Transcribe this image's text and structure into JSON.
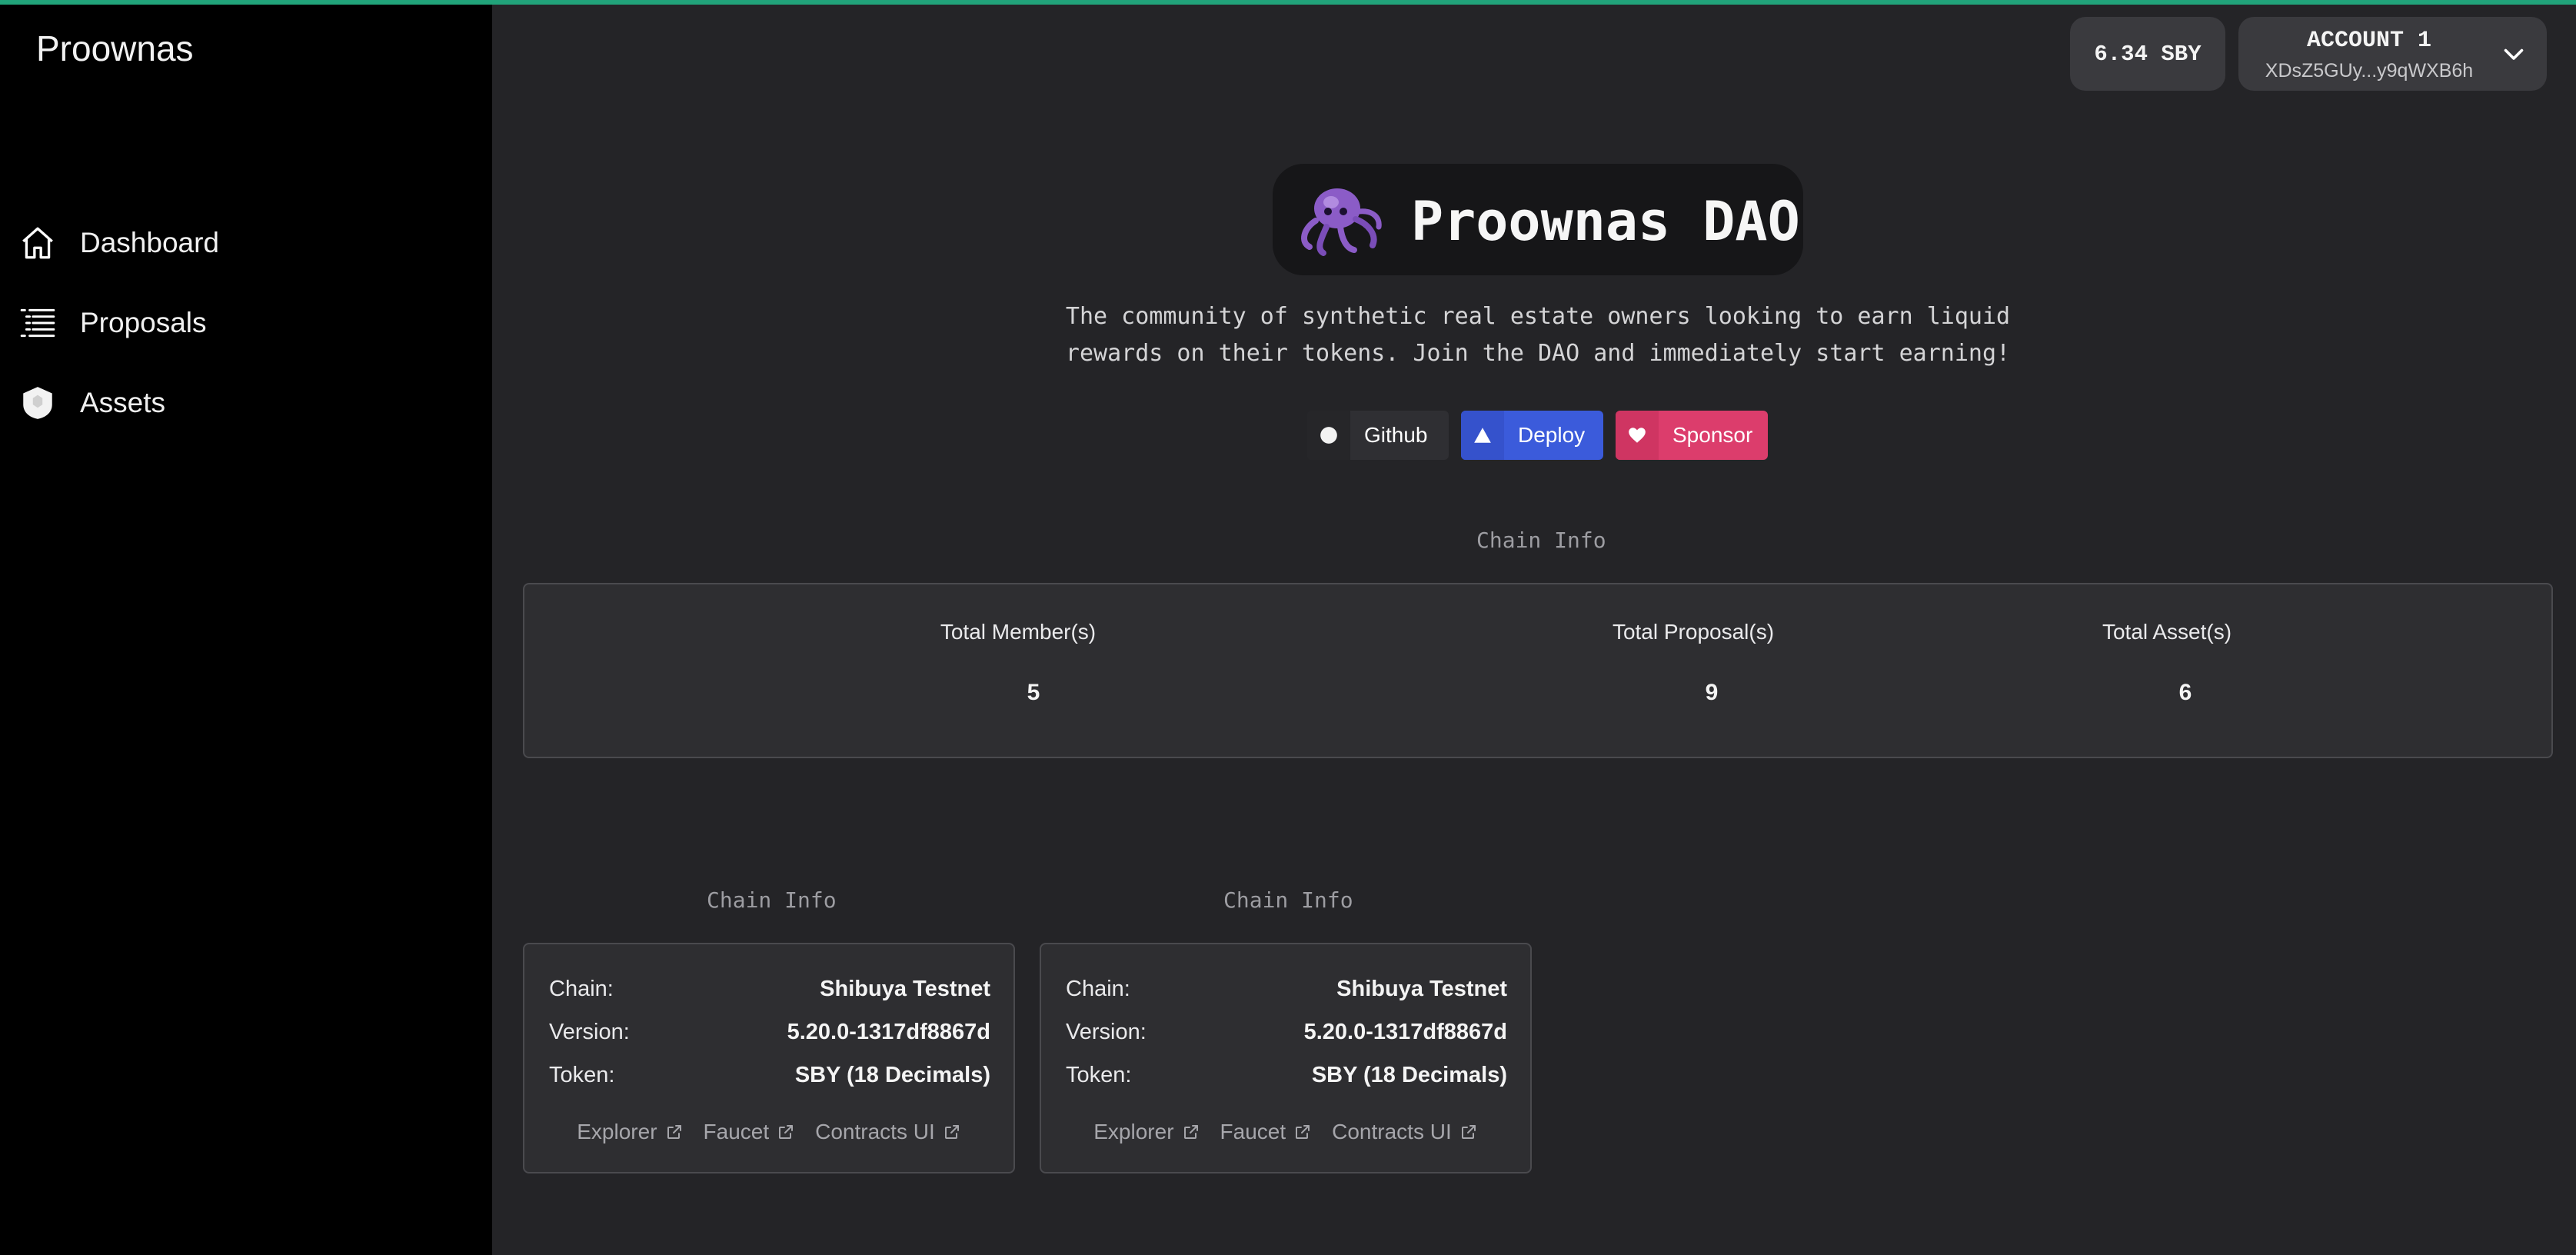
{
  "brand": "Proownas",
  "nav": [
    {
      "label": "Dashboard",
      "icon": "home-icon"
    },
    {
      "label": "Proposals",
      "icon": "list-icon"
    },
    {
      "label": "Assets",
      "icon": "shield-icon"
    }
  ],
  "header": {
    "balance": "6.34 SBY",
    "account_name": "ACCOUNT 1",
    "account_address": "XDsZ5GUy...y9qWXB6h"
  },
  "hero": {
    "title": "Proownas DAO",
    "description": "The community of synthetic real estate owners looking to earn liquid rewards on their tokens. Join the DAO and immediately start earning!"
  },
  "buttons": {
    "github": "Github",
    "deploy": "Deploy",
    "sponsor": "Sponsor"
  },
  "chain_info_label": "Chain Info",
  "stats": [
    {
      "label": "Total Member(s)",
      "value": "5"
    },
    {
      "label": "Total Proposal(s)",
      "value": "9"
    },
    {
      "label": "Total Asset(s)",
      "value": "6"
    }
  ],
  "cards": [
    {
      "label": "Chain Info",
      "chain_key": "Chain:",
      "chain": "Shibuya Testnet",
      "version_key": "Version:",
      "version": "5.20.0-1317df8867d",
      "token_key": "Token:",
      "token": "SBY (18 Decimals)",
      "links": [
        "Explorer",
        "Faucet",
        "Contracts UI"
      ]
    },
    {
      "label": "Chain Info",
      "chain_key": "Chain:",
      "chain": "Shibuya Testnet",
      "version_key": "Version:",
      "version": "5.20.0-1317df8867d",
      "token_key": "Token:",
      "token": "SBY (18 Decimals)",
      "links": [
        "Explorer",
        "Faucet",
        "Contracts UI"
      ]
    }
  ],
  "colors": {
    "accent_bar": "#21a37a",
    "deploy": "#3b5bdb",
    "sponsor": "#dc3d6c"
  }
}
